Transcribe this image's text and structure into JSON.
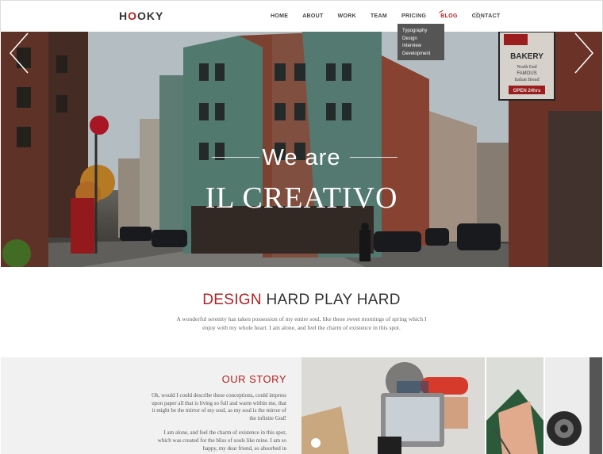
{
  "brand": {
    "logo_text": "HOOKY"
  },
  "nav": {
    "items": [
      {
        "label": "HOME"
      },
      {
        "label": "ABOUT"
      },
      {
        "label": "WORK"
      },
      {
        "label": "TEAM"
      },
      {
        "label": "PRICING"
      },
      {
        "label": "BLOG"
      },
      {
        "label": "CONTACT"
      }
    ],
    "active": "BLOG",
    "search_icon": "search-icon"
  },
  "dropdown": {
    "items": [
      "Typography",
      "Design",
      "Interview",
      "Development"
    ]
  },
  "hero": {
    "line1": "We are",
    "line2": "IL CREATIVO",
    "sign": {
      "l1": "BAKERY",
      "l2": "North End",
      "l3": "FAMOUS",
      "l4": "Italian Bread",
      "l5": "OPEN 24hrs"
    }
  },
  "design": {
    "title_accent": "DESIGN",
    "title_rest": " HARD PLAY HARD",
    "text": "A wonderful serenity has taken possession of my entire soul, like these sweet mornings of spring which I enjoy with my whole heart. I am alone, and feel the charm of existence in this spot."
  },
  "story": {
    "title": "OUR STORY",
    "p1": "Oh, would I could describe these conceptions, could impress upon paper all that is living so full and warm within me, that it might be the mirror of my soul, as my soul is the mirror of the infinite God!",
    "p2": "I am alone, and feel the charm of existence in this spot, which was created for the bliss of souls like mine. I am so happy, my dear friend, so absorbed in"
  },
  "colors": {
    "accent": "#b22222",
    "dropdown_bg": "#555555",
    "story_bg": "#f1f1f1"
  }
}
